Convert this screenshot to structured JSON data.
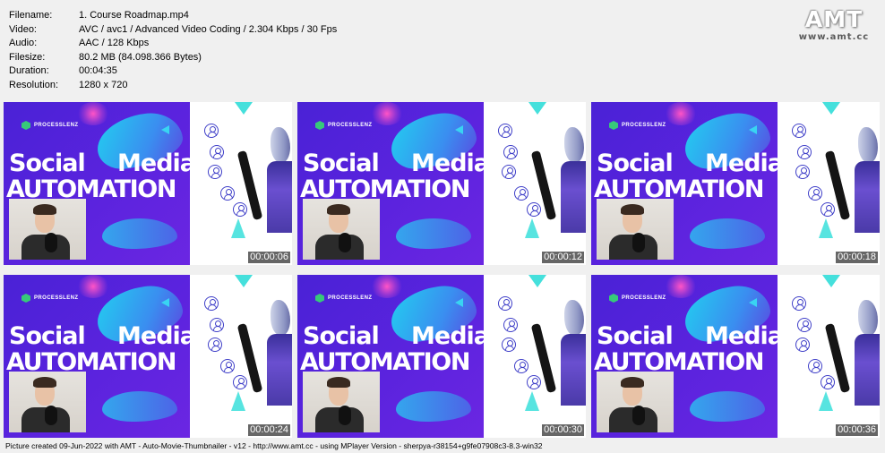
{
  "file_info": [
    {
      "label": "Filename:",
      "value": "1. Course Roadmap.mp4"
    },
    {
      "label": "Video:",
      "value": "AVC / avc1 / Advanced Video Coding / 2.304 Kbps / 30 Fps"
    },
    {
      "label": "Audio:",
      "value": "AAC / 128 Kbps"
    },
    {
      "label": "Filesize:",
      "value": "80.2 MB (84.098.366 Bytes)"
    },
    {
      "label": "Duration:",
      "value": "00:04:35"
    },
    {
      "label": "Resolution:",
      "value": "1280 x 720"
    }
  ],
  "logo": {
    "main": "AMT",
    "url": "www.amt.cc"
  },
  "slide": {
    "brand": "PROCESSLENZ",
    "title_word_1": "Social",
    "title_word_2": "Media",
    "title_line_2": "AUTOMATION"
  },
  "thumbnails": [
    {
      "timecode": "00:00:06"
    },
    {
      "timecode": "00:00:12"
    },
    {
      "timecode": "00:00:18"
    },
    {
      "timecode": "00:00:24"
    },
    {
      "timecode": "00:00:30"
    },
    {
      "timecode": "00:00:36"
    }
  ],
  "footer": "Picture created 09-Jun-2022 with AMT - Auto-Movie-Thumbnailer - v12 - http://www.amt.cc - using MPlayer Version - sherpya-r38154+g9fe07908c3-8.3-win32",
  "colors": {
    "background": "#f0f0f0",
    "slide_purple": "#5b23de",
    "accent_cyan": "#45e0dc",
    "brand_green": "#37c97a"
  },
  "icons": [
    "processlenz-logo-icon",
    "user-circle-icon",
    "robot-image"
  ]
}
